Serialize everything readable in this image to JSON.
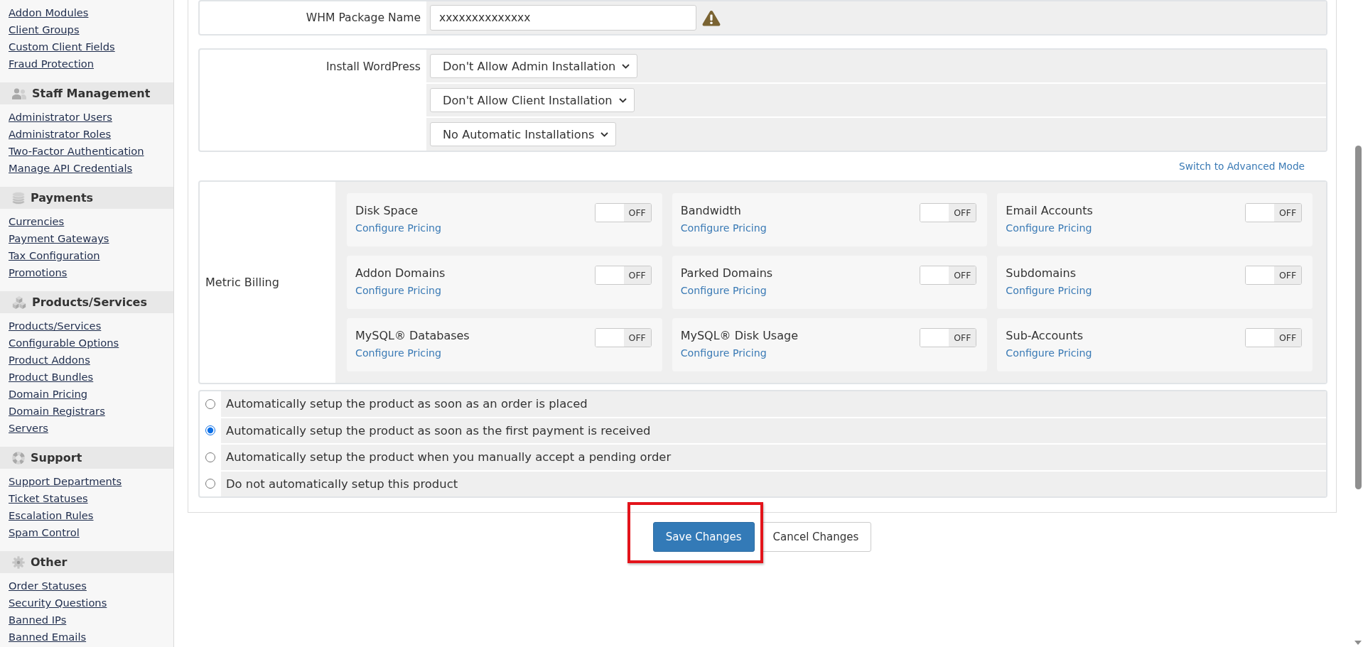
{
  "sidebar": {
    "links": [
      "Addon Modules",
      "Client Groups",
      "Custom Client Fields",
      "Fraud Protection"
    ],
    "sections": [
      {
        "title": "Staff Management",
        "links": [
          "Administrator Users",
          "Administrator Roles",
          "Two-Factor Authentication",
          "Manage API Credentials"
        ]
      },
      {
        "title": "Payments",
        "links": [
          "Currencies",
          "Payment Gateways",
          "Tax Configuration",
          "Promotions"
        ]
      },
      {
        "title": "Products/Services",
        "links": [
          "Products/Services",
          "Configurable Options",
          "Product Addons",
          "Product Bundles",
          "Domain Pricing",
          "Domain Registrars",
          "Servers"
        ]
      },
      {
        "title": "Support",
        "links": [
          "Support Departments",
          "Ticket Statuses",
          "Escalation Rules",
          "Spam Control"
        ]
      },
      {
        "title": "Other",
        "links": [
          "Order Statuses",
          "Security Questions",
          "Banned IPs",
          "Banned Emails"
        ]
      }
    ]
  },
  "package_name": {
    "label": "WHM Package Name",
    "value": "xxxxxxxxxxxxxx",
    "warning": true
  },
  "install_wordpress": {
    "label": "Install WordPress",
    "selects": [
      "Don't Allow Admin Installation",
      "Don't Allow Client Installation",
      "No Automatic Installations"
    ]
  },
  "advanced_mode_link": "Switch to Advanced Mode",
  "metric_billing": {
    "label": "Metric Billing",
    "metrics": [
      {
        "name": "Disk Space",
        "link": "Configure Pricing",
        "toggle": "OFF",
        "on": false
      },
      {
        "name": "Bandwidth",
        "link": "Configure Pricing",
        "toggle": "OFF",
        "on": false
      },
      {
        "name": "Email Accounts",
        "link": "Configure Pricing",
        "toggle": "OFF",
        "on": false
      },
      {
        "name": "Addon Domains",
        "link": "Configure Pricing",
        "toggle": "OFF",
        "on": false
      },
      {
        "name": "Parked Domains",
        "link": "Configure Pricing",
        "toggle": "OFF",
        "on": false
      },
      {
        "name": "Subdomains",
        "link": "Configure Pricing",
        "toggle": "OFF",
        "on": false
      },
      {
        "name": "MySQL® Databases",
        "link": "Configure Pricing",
        "toggle": "OFF",
        "on": false
      },
      {
        "name": "MySQL® Disk Usage",
        "link": "Configure Pricing",
        "toggle": "OFF",
        "on": false
      },
      {
        "name": "Sub-Accounts",
        "link": "Configure Pricing",
        "toggle": "OFF",
        "on": false
      }
    ]
  },
  "setup_options": [
    {
      "label": "Automatically setup the product as soon as an order is placed",
      "selected": false
    },
    {
      "label": "Automatically setup the product as soon as the first payment is received",
      "selected": true
    },
    {
      "label": "Automatically setup the product when you manually accept a pending order",
      "selected": false
    },
    {
      "label": "Do not automatically setup this product",
      "selected": false
    }
  ],
  "buttons": [
    {
      "label": "Save Changes",
      "kind": "primary",
      "highlighted": true
    },
    {
      "label": "Cancel Changes",
      "kind": "default",
      "highlighted": false
    }
  ]
}
